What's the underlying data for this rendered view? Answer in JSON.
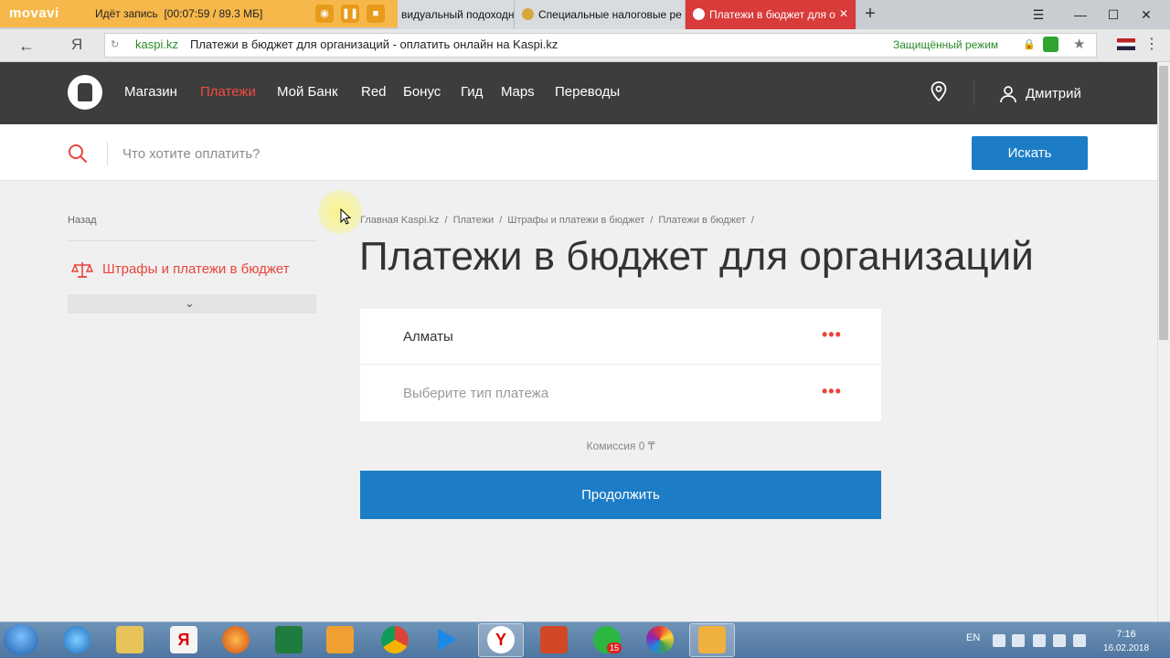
{
  "recorder": {
    "logo": "movavi",
    "status": "Идёт запись",
    "timer": "[00:07:59 / 89.3 МБ]"
  },
  "browser": {
    "tabs": [
      {
        "label": "видуальный подоходный"
      },
      {
        "label": "Специальные налоговые ре"
      },
      {
        "label": "Платежи в бюджет для о"
      }
    ],
    "address": {
      "domain": "kaspi.kz",
      "title": "Платежи в бюджет для организаций - оплатить онлайн на Kaspi.kz",
      "secure_label": "Защищённый режим"
    }
  },
  "header": {
    "nav": [
      {
        "label": "Магазин"
      },
      {
        "label": "Платежи"
      },
      {
        "label": "Мой Банк"
      },
      {
        "label": "Red"
      },
      {
        "label": "Бонус"
      },
      {
        "label": "Гид"
      },
      {
        "label": "Maps"
      },
      {
        "label": "Переводы"
      }
    ],
    "user_name": "Дмитрий"
  },
  "search": {
    "placeholder": "Что хотите оплатить?",
    "button_label": "Искать"
  },
  "sidebar": {
    "back_label": "Назад",
    "category_label": "Штрафы и платежи в бюджет"
  },
  "breadcrumbs": [
    "Главная Kaspi.kz",
    "Платежи",
    "Штрафы и платежи в бюджет",
    "Платежи в бюджет"
  ],
  "breadcrumb_sep": "/",
  "main": {
    "title": "Платежи в бюджет для организаций",
    "city": "Алматы",
    "payment_type_placeholder": "Выберите тип платежа",
    "dots": "•••",
    "commission": "Комиссия 0 ₸",
    "continue_label": "Продолжить"
  },
  "taskbar": {
    "lang": "EN",
    "whatsapp_badge": "15",
    "time": "7:16",
    "date": "16.02.2018"
  },
  "colors": {
    "accent_red": "#e8453c",
    "kaspi_blue": "#1c7dc6",
    "header_dark": "#3d3d3d"
  }
}
